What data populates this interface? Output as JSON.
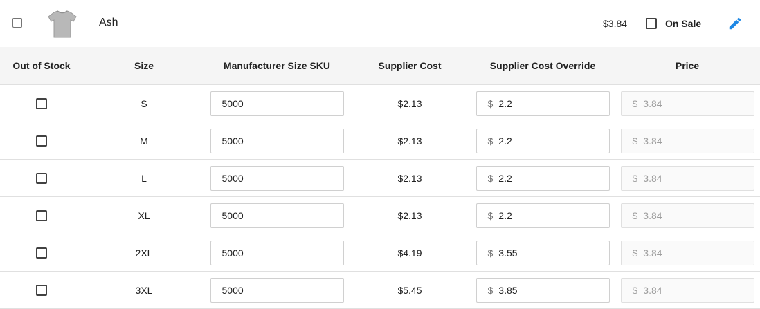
{
  "header": {
    "color_name": "Ash",
    "sale_price": "$3.84",
    "on_sale_label": "On Sale"
  },
  "table": {
    "columns": [
      "Out of Stock",
      "Size",
      "Manufacturer Size SKU",
      "Supplier Cost",
      "Supplier Cost Override",
      "Price"
    ],
    "currency_symbol": "$",
    "rows": [
      {
        "size": "S",
        "sku": "5000",
        "supplier_cost": "$2.13",
        "override": "2.2",
        "price": "3.84"
      },
      {
        "size": "M",
        "sku": "5000",
        "supplier_cost": "$2.13",
        "override": "2.2",
        "price": "3.84"
      },
      {
        "size": "L",
        "sku": "5000",
        "supplier_cost": "$2.13",
        "override": "2.2",
        "price": "3.84"
      },
      {
        "size": "XL",
        "sku": "5000",
        "supplier_cost": "$2.13",
        "override": "2.2",
        "price": "3.84"
      },
      {
        "size": "2XL",
        "sku": "5000",
        "supplier_cost": "$4.19",
        "override": "3.55",
        "price": "3.84"
      },
      {
        "size": "3XL",
        "sku": "5000",
        "supplier_cost": "$5.45",
        "override": "3.85",
        "price": "3.84"
      }
    ]
  },
  "colors": {
    "accent": "#1e88e5",
    "header_bg": "#f5f5f5",
    "divider": "#e0e0e0"
  }
}
